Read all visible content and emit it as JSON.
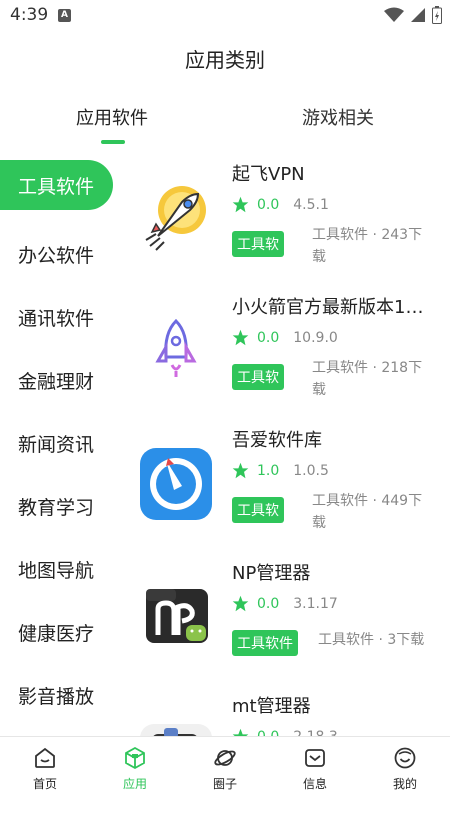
{
  "status": {
    "time": "4:39",
    "indicator": "A"
  },
  "header": {
    "title": "应用类别"
  },
  "tabs": [
    {
      "label": "应用软件",
      "active": true
    },
    {
      "label": "游戏相关",
      "active": false
    }
  ],
  "categories": [
    "工具软件",
    "办公软件",
    "通讯软件",
    "金融理财",
    "新闻资讯",
    "教育学习",
    "地图导航",
    "健康医疗",
    "影音播放"
  ],
  "apps": [
    {
      "name": "起飞VPN",
      "rating": "0.0",
      "version": "4.5.1",
      "tag": "工具软",
      "meta": "工具软件 · 243下载",
      "icon": "rocket-coin-icon"
    },
    {
      "name": "小火箭官方最新版本1…",
      "rating": "0.0",
      "version": "10.9.0",
      "tag": "工具软",
      "meta": "工具软件 · 218下载",
      "icon": "rocket-outline-icon"
    },
    {
      "name": "吾爱软件库",
      "rating": "1.0",
      "version": "1.0.5",
      "tag": "工具软",
      "meta": "工具软件 · 449下载",
      "icon": "compass-icon"
    },
    {
      "name": "NP管理器",
      "rating": "0.0",
      "version": "3.1.17",
      "tag": "工具软件",
      "meta": "工具软件 · 3下载",
      "icon": "np-manager-icon"
    },
    {
      "name": "mt管理器",
      "rating": "0.0",
      "version": "2.18.3",
      "tag": "",
      "meta": "",
      "icon": "mt-manager-icon"
    }
  ],
  "bottom_nav": [
    {
      "label": "首页",
      "icon": "home-icon",
      "active": false
    },
    {
      "label": "应用",
      "icon": "cube-icon",
      "active": true
    },
    {
      "label": "圈子",
      "icon": "planet-icon",
      "active": false
    },
    {
      "label": "信息",
      "icon": "message-icon",
      "active": false
    },
    {
      "label": "我的",
      "icon": "smile-icon",
      "active": false
    }
  ],
  "colors": {
    "accent": "#2fc55a"
  }
}
